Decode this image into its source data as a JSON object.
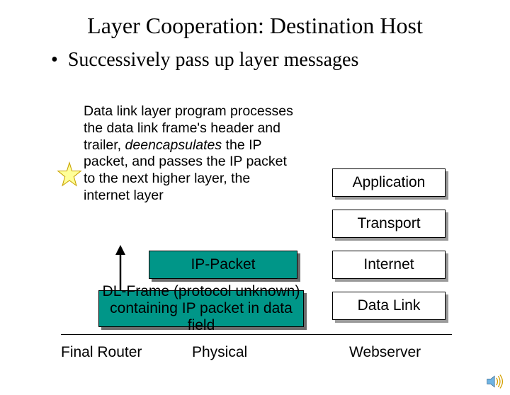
{
  "title": "Layer Cooperation: Destination Host",
  "bullet": "Successively pass up layer messages",
  "description": {
    "pre": "Data link layer program processes the data link frame's header and trailer, ",
    "em": "deencapsulates",
    "post": " the IP packet, and passes the IP packet to the next higher layer, the internet layer"
  },
  "right_layers": {
    "application": "Application",
    "transport": "Transport",
    "internet": "Internet",
    "datalink": "Data Link"
  },
  "left_boxes": {
    "ip_packet": "IP-Packet",
    "dl_frame_l1": "DL-Frame (protocol unknown)",
    "dl_frame_l2": "containing IP packet in data field"
  },
  "bottom_labels": {
    "final_router": "Final Router",
    "physical": "Physical",
    "webserver": "Webserver"
  },
  "icons": {
    "star": "star-icon",
    "speaker": "speaker-icon",
    "arrow_up": "arrow-up-icon"
  }
}
